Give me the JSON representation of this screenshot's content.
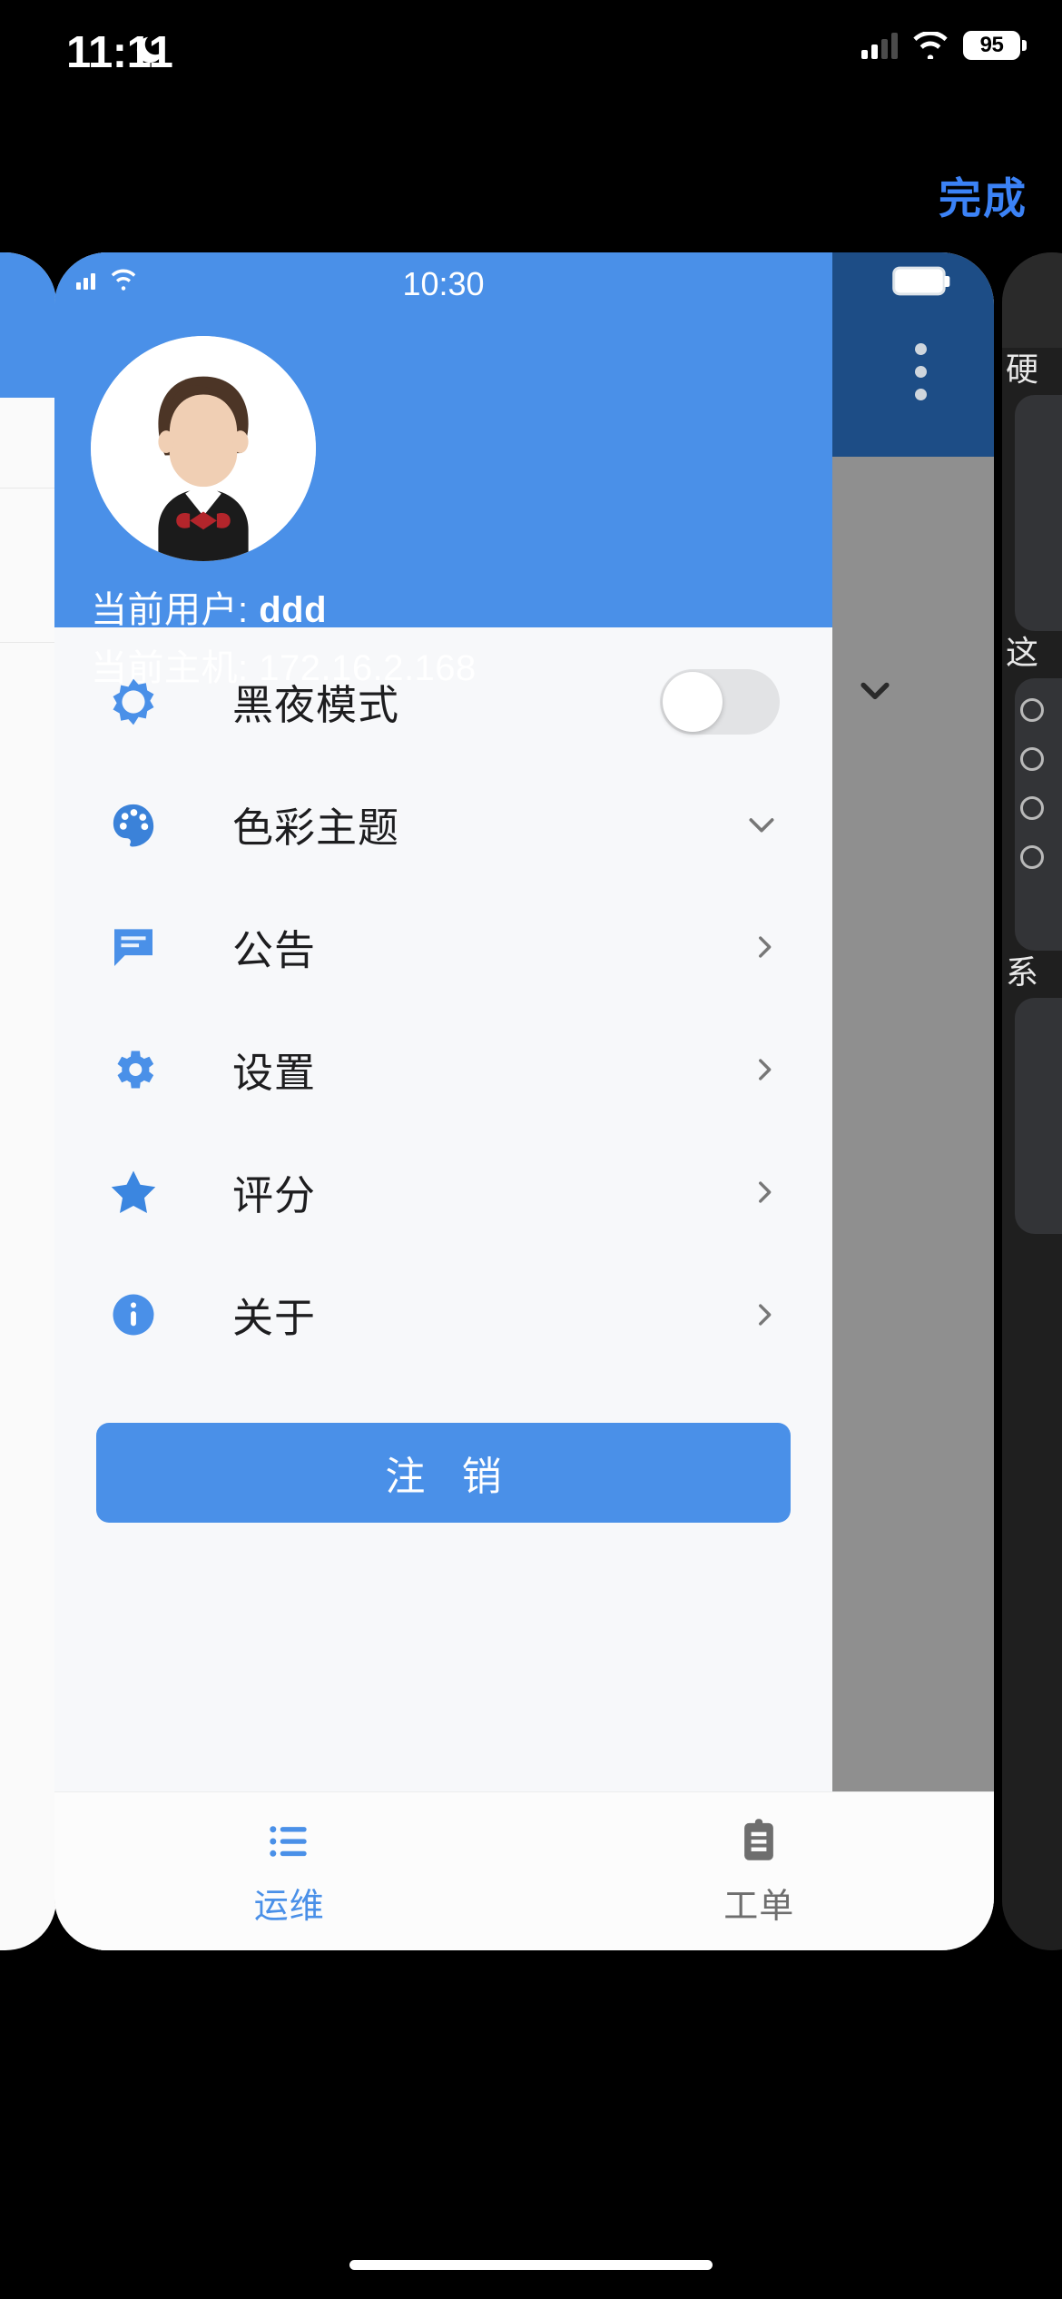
{
  "os_status": {
    "time": "11:11",
    "dnd_icon": "moon-icon",
    "signal_icon": "cellular-signal-icon",
    "wifi_icon": "wifi-icon",
    "battery_level": "95"
  },
  "header": {
    "done_label": "完成"
  },
  "app_card": {
    "inner_status": {
      "time": "10:30",
      "signal_icon": "cellular-signal-icon",
      "wifi_icon": "wifi-icon",
      "battery_icon": "battery-icon"
    },
    "drawer": {
      "avatar_icon": "user-avatar",
      "user_label": "当前用户: ",
      "user_value": "ddd",
      "host_label": "当前主机: ",
      "host_value": "172.16.2.168",
      "items": [
        {
          "label": "黑夜模式",
          "icon": "brightness-icon",
          "control": "toggle",
          "toggle_on": false
        },
        {
          "label": "色彩主题",
          "icon": "palette-icon",
          "control": "chevron-down"
        },
        {
          "label": "公告",
          "icon": "chat-bubble-icon",
          "control": "chevron-right"
        },
        {
          "label": "设置",
          "icon": "gear-icon",
          "control": "chevron-right"
        },
        {
          "label": "评分",
          "icon": "star-icon",
          "control": "chevron-right"
        },
        {
          "label": "关于",
          "icon": "info-icon",
          "control": "chevron-right"
        }
      ],
      "logout_label": "注 销"
    },
    "background_app": {
      "kebab_icon": "more-vertical-icon",
      "chevron_icon": "chevron-down-icon"
    },
    "tabbar": {
      "tabs": [
        {
          "label": "运维",
          "icon": "list-icon",
          "active": true
        },
        {
          "label": "工单",
          "icon": "clipboard-icon",
          "active": false
        }
      ]
    }
  },
  "colors": {
    "accent": "#4a90e8",
    "done_blue": "#3b82f6",
    "drawer_bg": "#f7f8fa",
    "bg_app_header": "#1d4d86",
    "bg_app_body": "#8f8f8f",
    "tab_inactive": "#6e6e6e"
  }
}
